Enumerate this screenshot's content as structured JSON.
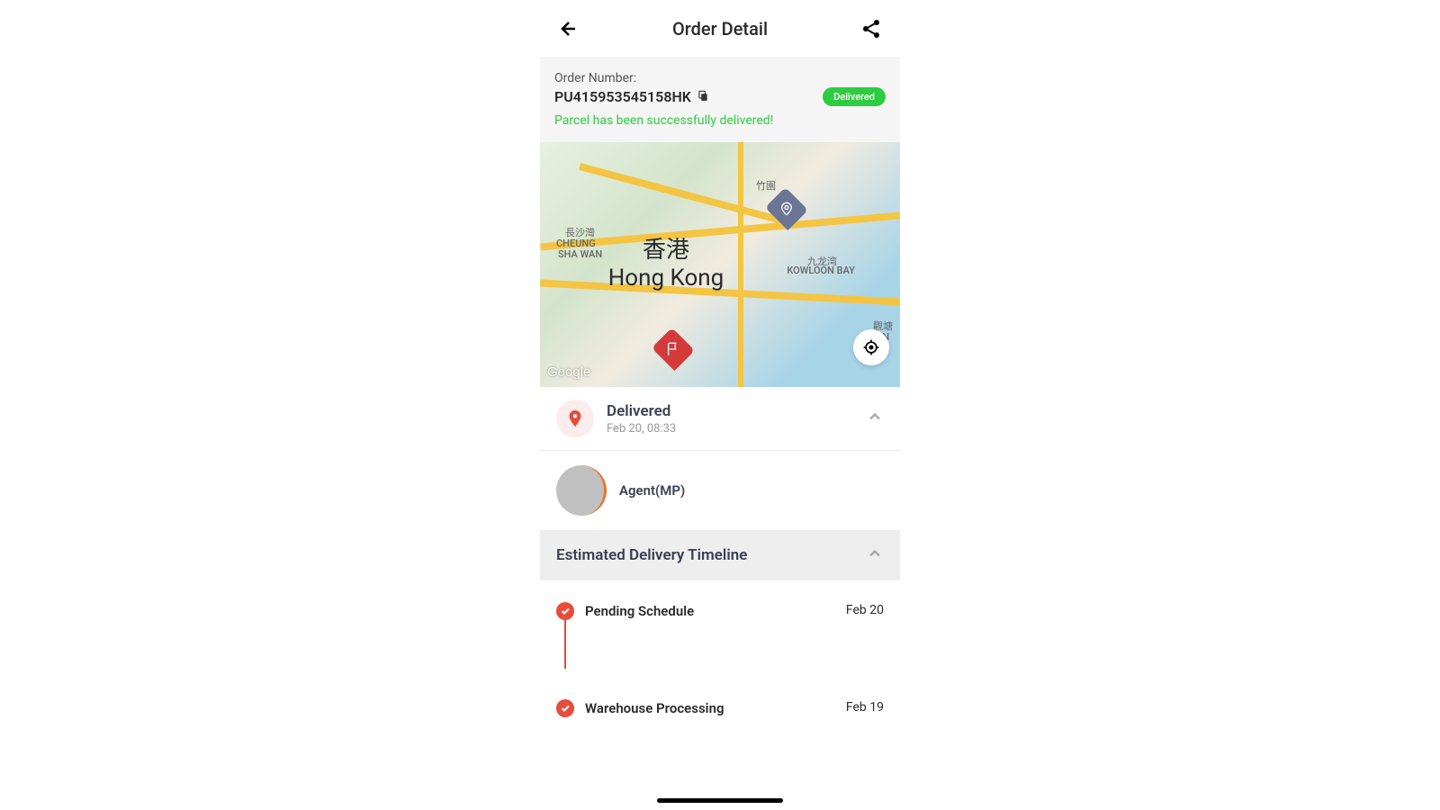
{
  "header": {
    "title": "Order Detail"
  },
  "order": {
    "label": "Order Number:",
    "number": "PU415953545158HK",
    "badge": "Delivered",
    "message": "Parcel has been successfully delivered!"
  },
  "map": {
    "city_zh": "香港",
    "city_en": "Hong Kong",
    "attribution": "Google",
    "labels": {
      "cheung_zh": "長沙灣",
      "cheung_en1": "CHEUNG",
      "cheung_en2": "SHA WAN",
      "kowloon_zh": "九龙湾",
      "kowloon_en": "KOWLOON BAY",
      "kwun_zh": "觀塘",
      "kwun_en": "KWUN",
      "zhuyan": "竹園"
    }
  },
  "status": {
    "title": "Delivered",
    "time": "Feb 20, 08:33"
  },
  "agent": {
    "name": "Agent(MP)"
  },
  "timeline": {
    "header": "Estimated Delivery Timeline",
    "items": [
      {
        "label": "Pending Schedule",
        "date": "Feb 20"
      },
      {
        "label": "Warehouse Processing",
        "date": "Feb 19"
      }
    ]
  }
}
